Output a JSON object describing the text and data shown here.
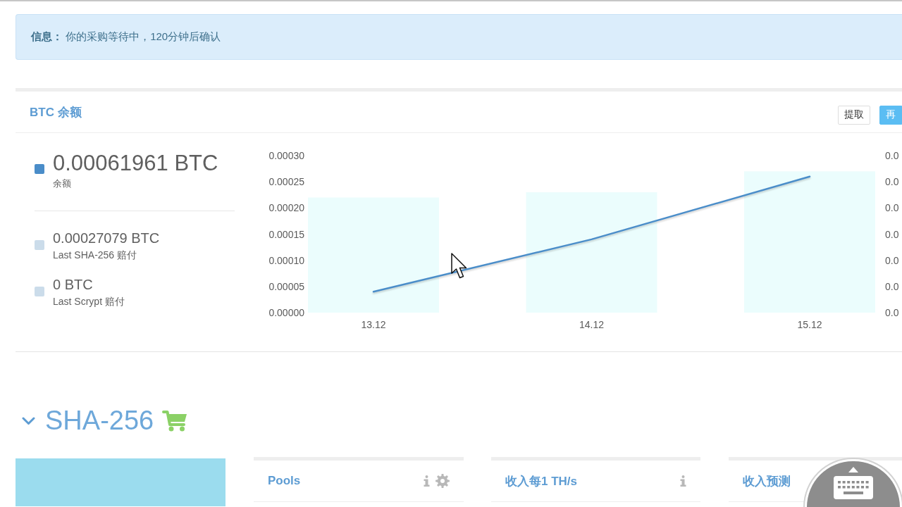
{
  "alert": {
    "text": "**信息：** 你的采购等待中，120分钟后确认"
  },
  "balance_panel": {
    "title": "BTC 余额",
    "buttons": [
      {
        "label": "提取",
        "kind": "default"
      },
      {
        "label": "再",
        "kind": "primary"
      }
    ],
    "legend": [
      {
        "value": "0.00061961 BTC",
        "caption": "余额",
        "color": "#4a8dc9",
        "kind": "main"
      },
      {
        "value": "0.00027079 BTC",
        "caption": "Last SHA-256 赔付",
        "color": "#cbdcea",
        "kind": "secondary"
      },
      {
        "value": "0 BTC",
        "caption": "Last Scrypt 赔付",
        "color": "#cbdcea",
        "kind": "secondary"
      }
    ],
    "chart_data": {
      "type": "bar",
      "categories": [
        "13.12",
        "14.12",
        "15.12"
      ],
      "ylim": [
        0,
        0.0003
      ],
      "yticks": [
        {
          "value": 0,
          "label": "0.00000"
        },
        {
          "value": 5e-05,
          "label": "0.00005"
        },
        {
          "value": 0.0001,
          "label": "0.00010"
        },
        {
          "value": 0.00015,
          "label": "0.00015"
        },
        {
          "value": 0.0002,
          "label": "0.00020"
        },
        {
          "value": 0.00025,
          "label": "0.00025"
        },
        {
          "value": 0.0003,
          "label": "0.00030"
        }
      ],
      "series": [
        {
          "color": "#ebfdfd",
          "values": [
            0.00022,
            0.00023,
            0.00027
          ]
        },
        {
          "type": "line",
          "color": "#4a8dc9",
          "values": [
            4e-05,
            0.00014,
            0.00026
          ]
        }
      ]
    },
    "right_axis_labels": [
      "0.0",
      "0.0",
      "0.0",
      "0.0",
      "0.0",
      "0.0",
      "0.0"
    ]
  },
  "section": {
    "title": "SHA-256",
    "expanded": true
  },
  "cards": [
    {
      "title": "Pools",
      "kind": "configurable"
    },
    {
      "title": "收入每1 TH/s",
      "kind": "informational"
    },
    {
      "title": "收入预测",
      "kind": "plain"
    }
  ]
}
